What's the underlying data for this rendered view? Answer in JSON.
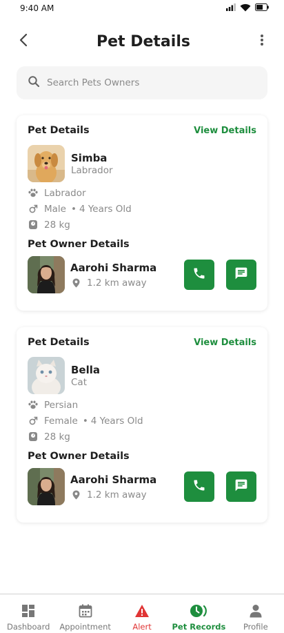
{
  "status_bar": {
    "time": "9:40 AM"
  },
  "header": {
    "title": "Pet Details"
  },
  "search": {
    "placeholder": "Search Pets Owners"
  },
  "cards": [
    {
      "section_title": "Pet Details",
      "view_details": "View Details",
      "pet_name": "Simba",
      "pet_subtitle": "Labrador",
      "breed": "Labrador",
      "gender": "Male",
      "separator": "•",
      "age": "4 Years Old",
      "weight": "28 kg",
      "owner_section_title": "Pet Owner Details",
      "owner_name": "Aarohi Sharma",
      "owner_distance": "1.2 km away"
    },
    {
      "section_title": "Pet Details",
      "view_details": "View Details",
      "pet_name": "Bella",
      "pet_subtitle": "Cat",
      "breed": "Persian",
      "gender": "Female",
      "separator": "•",
      "age": "4 Years Old",
      "weight": "28 kg",
      "owner_section_title": "Pet Owner Details",
      "owner_name": "Aarohi Sharma",
      "owner_distance": "1.2 km away"
    }
  ],
  "bottom_nav": {
    "items": [
      {
        "label": "Dashboard",
        "icon": "dashboard-icon"
      },
      {
        "label": "Appointment",
        "icon": "calendar-icon"
      },
      {
        "label": "Alert",
        "icon": "alert-triangle-icon"
      },
      {
        "label": "Pet Records",
        "icon": "pet-records-icon"
      },
      {
        "label": "Profile",
        "icon": "person-icon"
      }
    ],
    "active": "Pet Records"
  },
  "colors": {
    "accent": "#1e8e3e",
    "alert": "#e03535",
    "muted_text": "#8a8a8a",
    "search_bg": "#f5f5f5"
  }
}
